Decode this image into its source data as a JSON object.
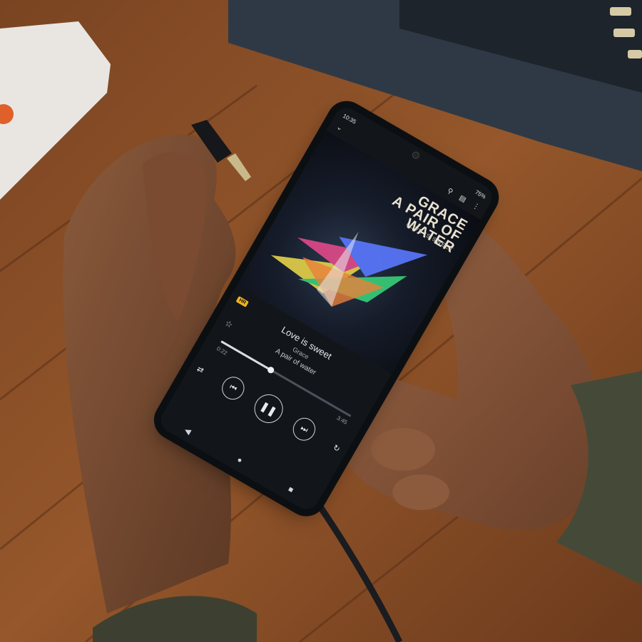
{
  "status": {
    "time": "10:35",
    "battery": "75%"
  },
  "album": {
    "title_line1": "GRACE",
    "title_line2": "A PAIR OF",
    "title_line3": "WATER",
    "artist_small": "LOVE IS SWEET"
  },
  "track": {
    "title": "Love is sweet",
    "album": "Grace",
    "artist": "A pair of water"
  },
  "badge": "HR",
  "times": {
    "elapsed": "0:22",
    "total": "3:45"
  },
  "icons": {
    "search": "search-icon",
    "cast": "cast-icon",
    "more": "more-icon",
    "back": "chevron-down-icon",
    "star": "star-icon",
    "shuffle": "shuffle-icon",
    "repeat": "repeat-icon",
    "prev": "previous-icon",
    "play": "pause-icon",
    "next": "next-icon",
    "queue": "queue-icon"
  },
  "colors": {
    "wood": "#8a4f25",
    "badge": "#f3b51c",
    "screen": "#12161b"
  }
}
